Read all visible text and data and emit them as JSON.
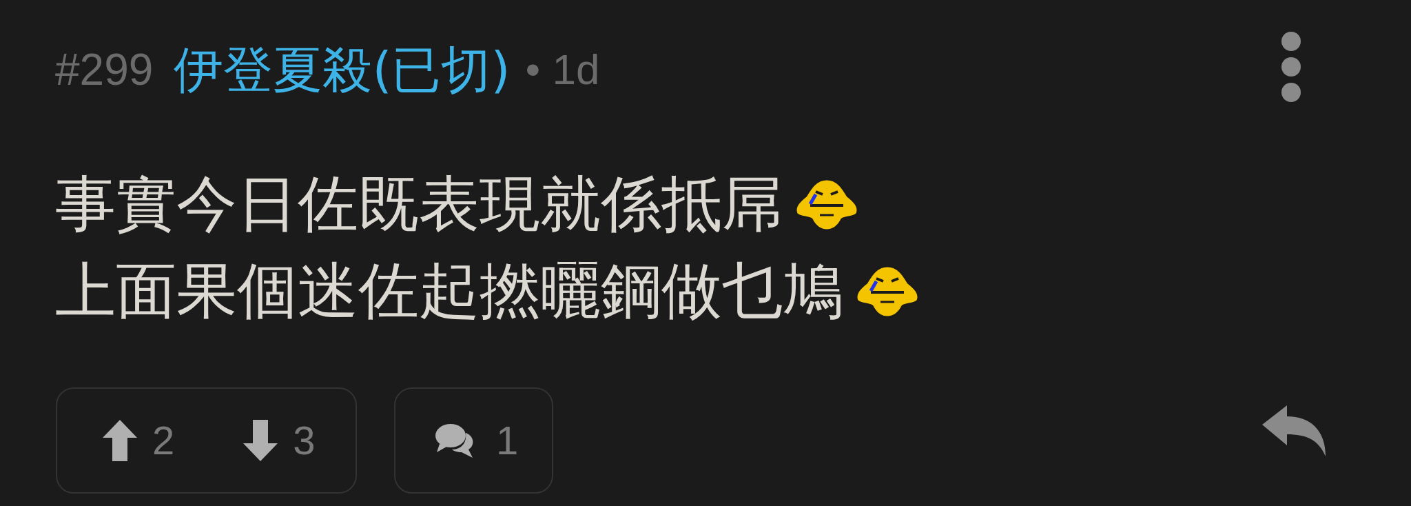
{
  "post": {
    "number": "#299",
    "author": "伊登夏殺(已切)",
    "time": "• 1d"
  },
  "body": [
    {
      "text": "事實今日佐既表現就係抵屌",
      "emoji": true
    },
    {
      "text": "上面果個迷佐起撚曬鋼做乜鳩",
      "emoji": true
    }
  ],
  "votes": {
    "up": "2",
    "down": "3"
  },
  "comments": {
    "count": "1"
  }
}
